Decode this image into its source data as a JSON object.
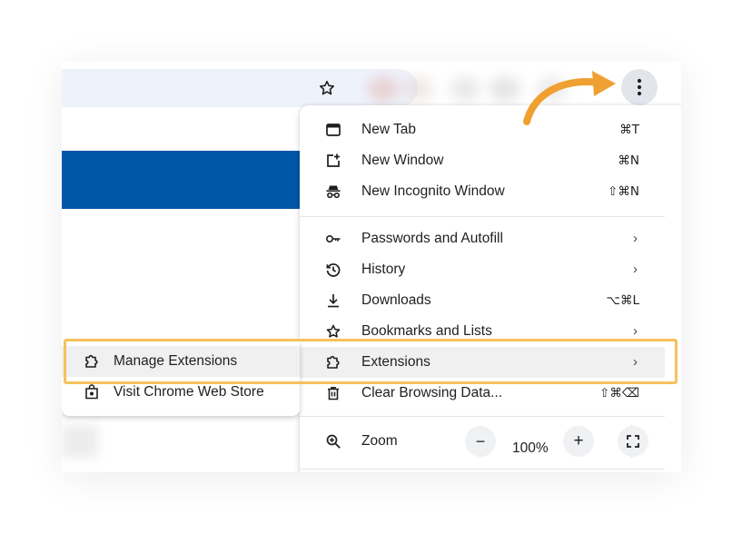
{
  "theme": {
    "accent_blue": "#0057a8",
    "highlight_yellow": "#f6c15c",
    "arrow_orange": "#f0a030"
  },
  "toolbar": {
    "bookmark_icon": "star-outline-icon",
    "menu_icon": "vertical-dots-icon"
  },
  "menu": {
    "groups": [
      [
        {
          "icon": "new-tab-icon",
          "label": "New Tab",
          "shortcut": "⌘T"
        },
        {
          "icon": "new-window-icon",
          "label": "New Window",
          "shortcut": "⌘N"
        },
        {
          "icon": "incognito-icon",
          "label": "New Incognito Window",
          "shortcut": "⇧⌘N"
        }
      ],
      [
        {
          "icon": "key-icon",
          "label": "Passwords and Autofill",
          "chevron": "›"
        },
        {
          "icon": "history-icon",
          "label": "History",
          "chevron": "›"
        },
        {
          "icon": "download-icon",
          "label": "Downloads",
          "shortcut": "⌥⌘L"
        },
        {
          "icon": "star-outline-icon",
          "label": "Bookmarks and Lists",
          "chevron": "›"
        },
        {
          "icon": "puzzle-icon",
          "label": "Extensions",
          "chevron": "›"
        },
        {
          "icon": "trash-icon",
          "label": "Clear Browsing Data...",
          "shortcut": "⇧⌘⌫"
        }
      ]
    ],
    "zoom": {
      "label": "Zoom",
      "minus": "−",
      "value": "100%",
      "plus": "+",
      "fullscreen_icon": "fullscreen-icon"
    }
  },
  "submenu": {
    "items": [
      {
        "icon": "puzzle-icon",
        "label": "Manage Extensions"
      },
      {
        "icon": "web-store-icon",
        "label": "Visit Chrome Web Store"
      }
    ]
  }
}
